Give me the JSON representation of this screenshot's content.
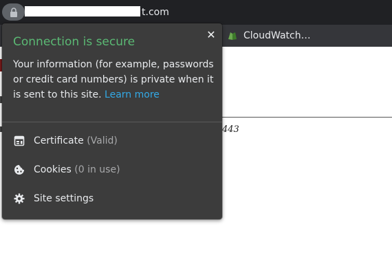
{
  "browser": {
    "url_visible_suffix": "t.com",
    "url_redacted": true
  },
  "bookmarks": [
    {
      "label": "CloudWatch…",
      "icon": "cloudwatch-icon"
    }
  ],
  "page": {
    "port_fragment": "443"
  },
  "popup": {
    "title": "Connection is secure",
    "description": "Your information (for example, passwords or credit card numbers) is private when it is sent to this site.",
    "learn_more": "Learn more",
    "items": [
      {
        "label": "Certificate",
        "status": "(Valid)",
        "icon": "certificate-icon"
      },
      {
        "label": "Cookies",
        "status": "(0 in use)",
        "icon": "cookie-icon"
      },
      {
        "label": "Site settings",
        "status": "",
        "icon": "gear-icon"
      }
    ],
    "close_symbol": "✕"
  },
  "colors": {
    "secure_green": "#5bb974",
    "link_blue": "#33a9e6",
    "popup_bg": "#3c3c3c",
    "toolbar_bg": "#202124"
  }
}
